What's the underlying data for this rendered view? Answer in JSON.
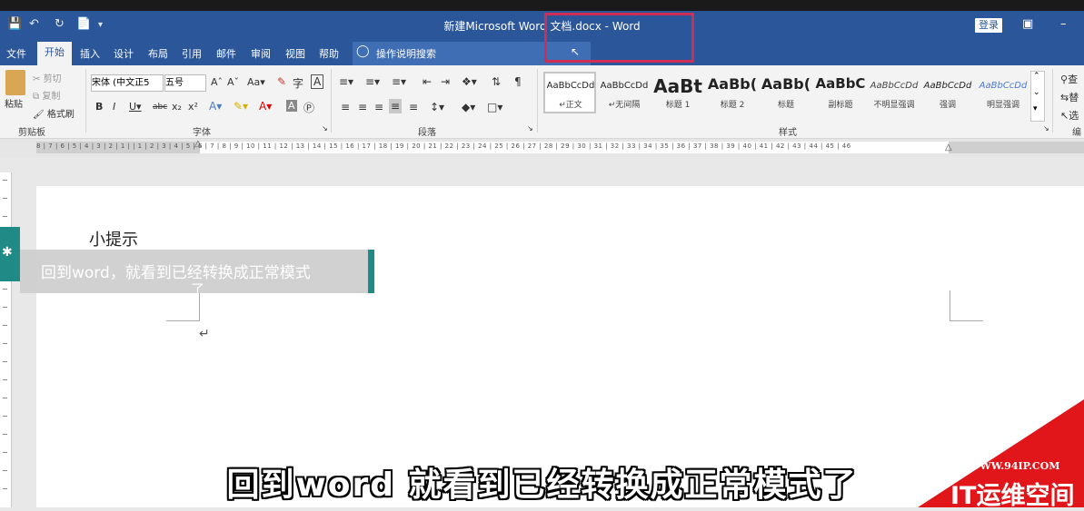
{
  "window": {
    "title": "新建Microsoft Word 文档.docx - Word",
    "login_label": "登录",
    "quick_access": [
      "save-icon",
      "undo-icon",
      "redo-icon",
      "new-doc-icon",
      "customize-icon"
    ]
  },
  "tabs": {
    "file": "文件",
    "home": "开始",
    "insert": "插入",
    "design": "设计",
    "layout": "布局",
    "references": "引用",
    "mailings": "邮件",
    "review": "审阅",
    "view": "视图",
    "help": "帮助",
    "tell_me": "操作说明搜索"
  },
  "ribbon": {
    "clipboard": {
      "paste": "粘贴",
      "cut": "剪切",
      "copy": "复制",
      "format_painter": "格式刷",
      "label": "剪贴板"
    },
    "font": {
      "font_name": "宋体 (中文正5",
      "font_size": "五号",
      "label": "字体"
    },
    "paragraph": {
      "label": "段落"
    },
    "styles": {
      "label": "样式",
      "items": [
        {
          "sample": "AaBbCcDd",
          "name": "↵正文"
        },
        {
          "sample": "AaBbCcDd",
          "name": "↵无间隔"
        },
        {
          "sample": "AaBt",
          "name": "标题 1"
        },
        {
          "sample": "AaBb(",
          "name": "标题 2"
        },
        {
          "sample": "AaBb(",
          "name": "标题"
        },
        {
          "sample": "AaBbC",
          "name": "副标题"
        },
        {
          "sample": "AaBbCcDd",
          "name": "不明显强调"
        },
        {
          "sample": "AaBbCcDd",
          "name": "强调"
        },
        {
          "sample": "AaBbCcDd",
          "name": "明显强调"
        }
      ]
    },
    "editing": {
      "find": "查",
      "replace": "替",
      "select": "选",
      "label": "编"
    }
  },
  "ruler": {
    "numbers": "8 | 7 | 6 | 5 | 4 | 3 | 2 | 1 |  | 1 | 2 | 3 | 4 | 5 | 6 | 7 | 8 | 9 | 10 | 11 | 12 | 13 | 14 | 15 | 16 | 17 | 18 | 19 | 20 | 21 | 22 | 23 | 24 | 25 | 26 | 27 | 28 | 29 | 30 | 31 | 32 | 33 | 34 | 35 | 36 | 37 | 38 | 39 | 40 | 41 | 42 | 43 | 44 | 45 | 46"
  },
  "document": {
    "hint_text": "小提示",
    "paragraph_mark": "↵"
  },
  "overlay": {
    "line1": "回到word，就看到已经转换成正常模式",
    "line2": "了"
  },
  "subtitle": "回到word 就看到已经转换成正常模式了",
  "watermark": {
    "url": "WWW.94IP.COM",
    "name": "IT运维空间"
  },
  "colors": {
    "word_blue": "#2b579a",
    "highlight": "#d02d55",
    "teal": "#1f8a86",
    "watermark_red": "#e0161a"
  }
}
